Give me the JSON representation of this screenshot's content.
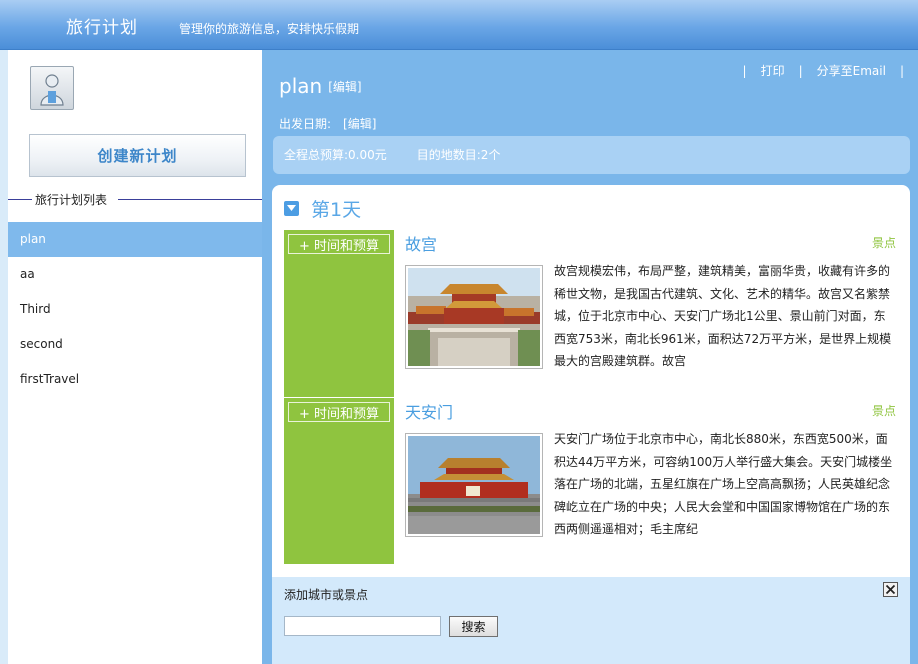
{
  "header": {
    "title": "旅行计划",
    "subtitle": "管理你的旅游信息，安排快乐假期"
  },
  "sidebar": {
    "create_label": "创建新计划",
    "list_title": "旅行计划列表",
    "plans": [
      "plan",
      "aa",
      "Third",
      "second",
      "firstTravel"
    ],
    "active_index": 0
  },
  "plan": {
    "name": "plan",
    "edit_label": "[编辑]",
    "depart_label": "出发日期:",
    "depart_edit_label": "[编辑]",
    "budget_text": "全程总预算:0.00元",
    "dest_count_text": "目的地数目:2个"
  },
  "actions": {
    "sep": "|",
    "print": "打印",
    "share": "分享至Email"
  },
  "days": [
    {
      "title": "第1天",
      "spots": [
        {
          "name": "故宫",
          "type": "景点",
          "time_budget_label": "+ 时间和预算",
          "description": "故宫规模宏伟，布局严整，建筑精美，富丽华贵，收藏有许多的稀世文物，是我国古代建筑、文化、艺术的精华。故宫又名紫禁城，位于北京市中心、天安门广场北1公里、景山前门对面，东西宽753米，南北长961米，面积达72万平方米，是世界上规模最大的宫殿建筑群。故宫"
        },
        {
          "name": "天安门",
          "type": "景点",
          "time_budget_label": "+ 时间和预算",
          "description": "天安门广场位于北京市中心，南北长880米，东西宽500米，面积达44万平方米，可容纳100万人举行盛大集会。天安门城楼坐落在广场的北端，五星红旗在广场上空高高飘扬；人民英雄纪念碑屹立在广场的中央；人民大会堂和中国国家博物馆在广场的东西两侧遥遥相对；毛主席纪"
        }
      ]
    }
  ],
  "add_panel": {
    "title": "添加城市或景点",
    "input_value": "",
    "search_label": "搜索"
  },
  "colors": {
    "header_blue": "#4b8ed8",
    "main_blue": "#7ab6ea",
    "green": "#8fc43f",
    "link_blue": "#4a9ee0"
  }
}
